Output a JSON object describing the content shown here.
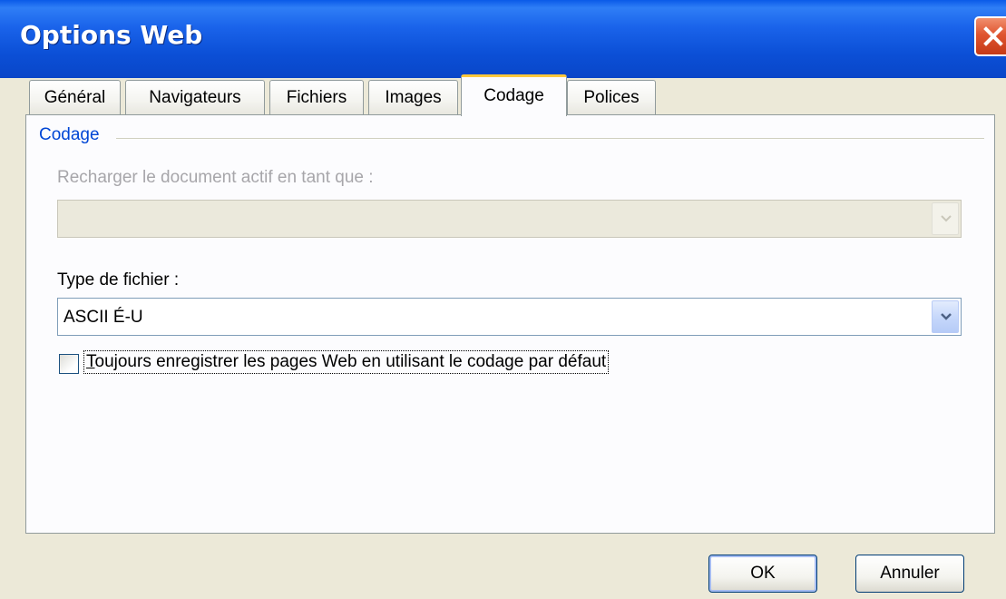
{
  "window": {
    "title": "Options Web"
  },
  "tabs": [
    {
      "label": "Général"
    },
    {
      "label": "Navigateurs"
    },
    {
      "label": "Fichiers"
    },
    {
      "label": "Images"
    },
    {
      "label": "Codage",
      "active": true
    },
    {
      "label": "Polices"
    }
  ],
  "group": {
    "label": "Codage"
  },
  "reload": {
    "label": "Recharger le document actif en tant que :",
    "value": "",
    "enabled": false
  },
  "filetype": {
    "label": "Type de fichier :",
    "value": "ASCII É-U"
  },
  "always_save": {
    "label_pre": "",
    "label_accel": "T",
    "label_post": "oujours enregistrer les pages Web en utilisant le codage par défaut",
    "checked": false
  },
  "buttons": {
    "ok": "OK",
    "cancel": "Annuler"
  },
  "colors": {
    "title_bar": "#0a5ae8",
    "dialog_bg": "#ece9d8",
    "group_label": "#0046d5",
    "active_tab_accent": "#ffc83c"
  }
}
